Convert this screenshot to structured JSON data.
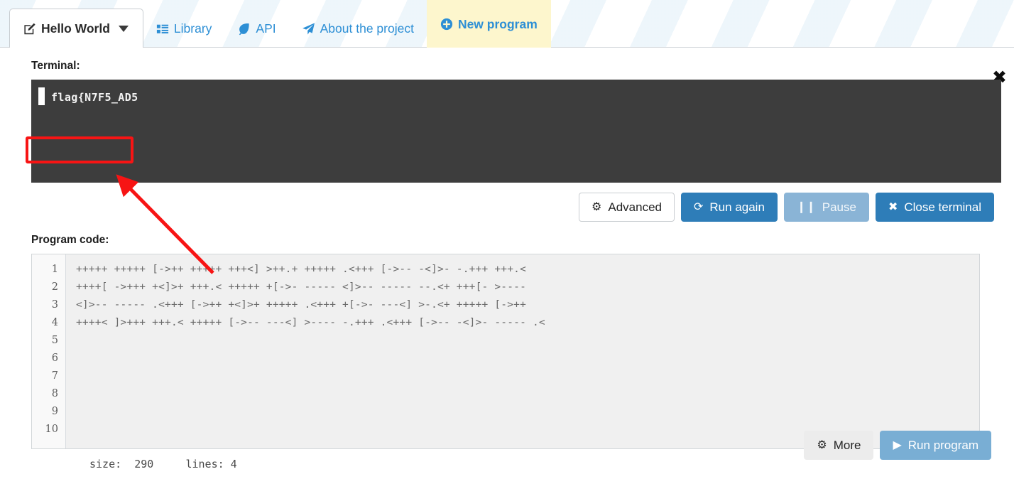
{
  "tabs": [
    {
      "label": "Hello World",
      "icon": "edit-square-icon",
      "state": "active-program",
      "has_caret": true
    },
    {
      "label": "Library",
      "icon": "grid-list-icon",
      "state": "link"
    },
    {
      "label": "API",
      "icon": "leaf-icon",
      "state": "link"
    },
    {
      "label": "About the project",
      "icon": "paper-plane-icon",
      "state": "link"
    },
    {
      "label": "New program",
      "icon": "plus-circle-icon",
      "state": "highlighted"
    }
  ],
  "terminal": {
    "label": "Terminal:",
    "output": "flag{N7F5_AD5",
    "close_icon": "close-x-icon",
    "background": "#3d3d3d"
  },
  "annotation": {
    "box_color": "#f71414",
    "arrow_color": "#f71414",
    "target": "flag{N7F5_AD5"
  },
  "terminal_buttons": [
    {
      "label": "Advanced",
      "icon": "gear-icon",
      "style": "default"
    },
    {
      "label": "Run again",
      "icon": "refresh-icon",
      "style": "primary"
    },
    {
      "label": "Pause",
      "icon": "pause-icon",
      "style": "muted"
    },
    {
      "label": "Close terminal",
      "icon": "x-icon",
      "style": "primary"
    }
  ],
  "editor": {
    "label": "Program code:",
    "line_numbers": [
      "1",
      "2",
      "3",
      "4",
      "5",
      "6",
      "7",
      "8",
      "9",
      "10"
    ],
    "lines": [
      "+++++ +++++ [->++ +++++ +++<] >++.+ +++++ .<+++ [->-- -<]>- -.+++ +++.<",
      "++++[ ->+++ +<]>+ +++.< +++++ +[->- ----- <]>-- ----- --.<+ +++[- >----",
      "<]>-- ----- .<+++ [->++ +<]>+ +++++ .<+++ +[->- ---<] >-.<+ +++++ [->++",
      "++++< ]>+++ +++.< +++++ [->-- ---<] >---- -.+++ .<+++ [->-- -<]>- ----- .<"
    ]
  },
  "status": {
    "text": "size:  290     lines: 4",
    "size_label": "size:",
    "size_value": "290",
    "lines_label": "lines:",
    "lines_value": "4"
  },
  "bottom_buttons": [
    {
      "label": "More",
      "icon": "gear-icon",
      "style": "grey"
    },
    {
      "label": "Run program",
      "icon": "play-icon",
      "style": "run"
    }
  ],
  "colors": {
    "link_blue": "#2d8fd5",
    "primary_blue": "#2e7db8",
    "muted_blue": "#8ab4d6",
    "run_blue": "#79aed4",
    "highlight_yellow": "#fdf6cd",
    "terminal_bg": "#3d3d3d",
    "annotation_red": "#f71414"
  }
}
